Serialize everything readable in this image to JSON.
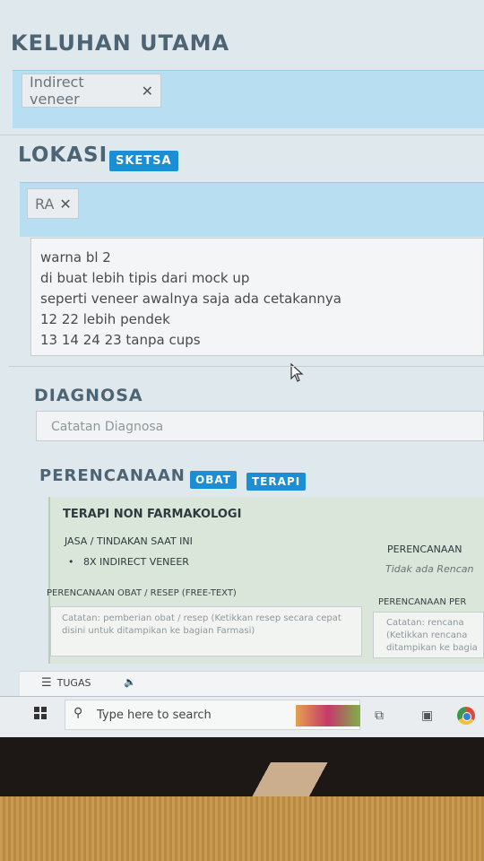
{
  "keluhan": {
    "title": "KELUHAN UTAMA",
    "tag": "Indirect veneer"
  },
  "lokasi": {
    "title": "LOKASI",
    "sketsa_label": "SKETSA",
    "tag": "RA"
  },
  "notes": [
    "warna bl 2",
    "di buat lebih tipis dari mock up",
    "seperti veneer awalnya saja ada cetakannya",
    "12 22 lebih pendek",
    "13 14 24 23 tanpa cups"
  ],
  "diagnosa": {
    "title": "DIAGNOSA",
    "placeholder": "Catatan Diagnosa"
  },
  "perencanaan": {
    "title": "PERENCANAAN",
    "obat_label": "OBAT",
    "terapi_label": "TERAPI",
    "terapi_non": "TERAPI NON FARMAKOLOGI",
    "jasa_label": "JASA / TINDAKAN SAAT INI",
    "jasa_item": "8X INDIRECT VENEER",
    "perencanaan_col": "PERENCANAAN",
    "perencanaan_empty": "Tidak ada Rencan",
    "obat_resep_label": "PERENCANAAN OBAT / RESEP (FREE-TEXT)",
    "obat_resep_placeholder": "Catatan: pemberian obat / resep (Ketikkan resep secara cepat disini untuk ditampikan ke bagian Farmasi)",
    "per_label": "PERENCANAAN PER",
    "per_placeholder": "Catatan: rencana (Ketikkan rencana ditampikan ke bagia"
  },
  "tugas": {
    "label": "TUGAS"
  },
  "taskbar": {
    "search_placeholder": "Type here to search"
  }
}
